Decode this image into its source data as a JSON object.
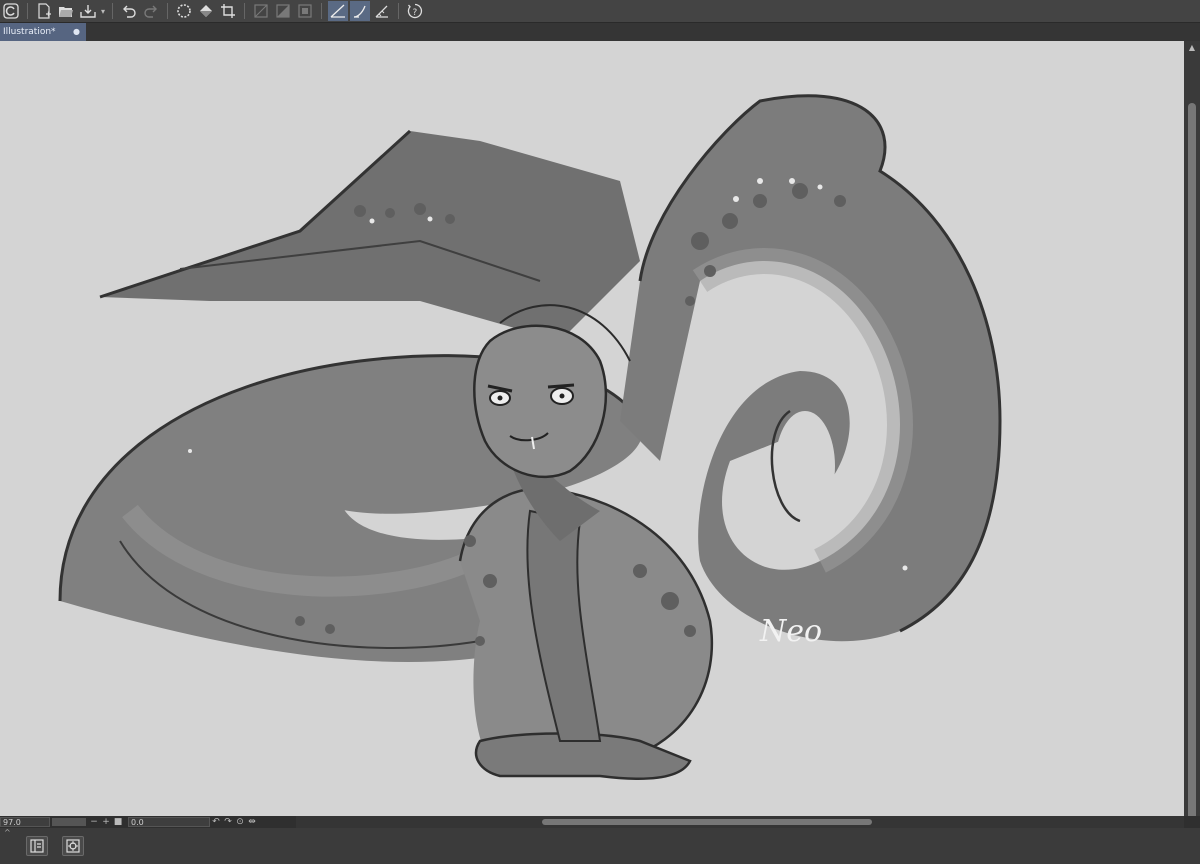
{
  "toolbar": {
    "items": [
      {
        "id": "app-menu",
        "icon": "app-logo-icon"
      },
      {
        "id": "new",
        "icon": "new-file-icon"
      },
      {
        "id": "open",
        "icon": "open-folder-icon"
      },
      {
        "id": "save",
        "icon": "save-icon"
      },
      {
        "id": "undo",
        "icon": "undo-icon"
      },
      {
        "id": "redo",
        "icon": "redo-icon"
      },
      {
        "id": "clear",
        "icon": "clear-icon"
      },
      {
        "id": "fill",
        "icon": "fill-icon"
      },
      {
        "id": "crop",
        "icon": "crop-icon"
      },
      {
        "id": "selection-a",
        "icon": "selection-icon"
      },
      {
        "id": "selection-b",
        "icon": "selection-icon"
      },
      {
        "id": "selection-c",
        "icon": "selection-icon"
      },
      {
        "id": "ruler",
        "icon": "ruler-icon"
      },
      {
        "id": "snap",
        "icon": "snap-icon"
      },
      {
        "id": "ruler-settings",
        "icon": "ruler-settings-icon"
      },
      {
        "id": "help",
        "icon": "help-icon"
      }
    ]
  },
  "document_tab": {
    "title": "Illustration*",
    "modified_marker": "●"
  },
  "canvas": {
    "background_color": "#d4d4d4",
    "signature_text": "Neo"
  },
  "status_bar": {
    "zoom_value": "97.0",
    "zoom_out_label": "−",
    "zoom_in_label": "+",
    "rotation_value": "0.0"
  },
  "colors": {
    "accent": "#566581",
    "toolbar_bg": "#444444",
    "panel_bg": "#3b3b3b"
  }
}
